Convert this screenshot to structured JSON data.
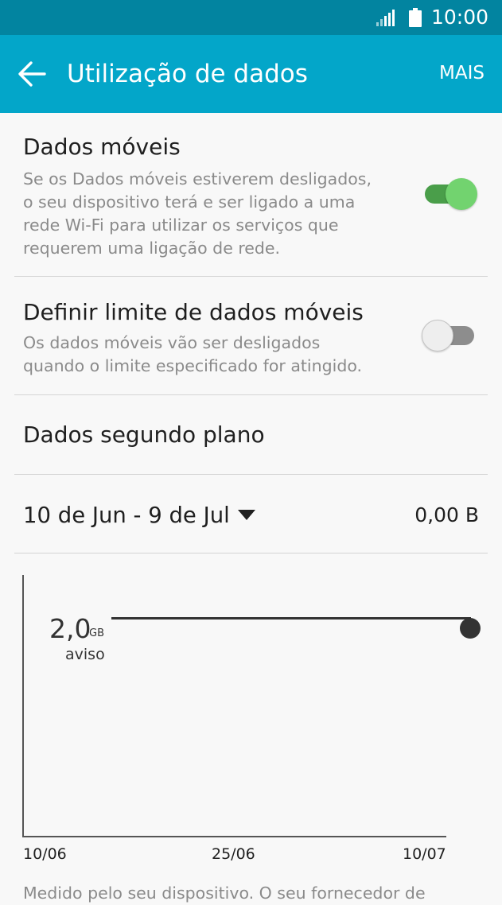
{
  "status_bar": {
    "time": "10:00",
    "signal_icon": "signal-icon",
    "battery_icon": "battery-icon"
  },
  "app_bar": {
    "title": "Utilização de dados",
    "more_label": "MAIS",
    "back_icon": "arrow-left-icon",
    "background_color": "#03a6c9"
  },
  "settings": {
    "mobile_data": {
      "title": "Dados móveis",
      "description_lines": [
        "Se os Dados móveis estiverem desligados,",
        "o seu dispositivo terá e ser ligado a uma",
        "rede Wi-Fi para utilizar os serviços que",
        "requerem uma ligação de rede."
      ],
      "enabled": true
    },
    "data_limit": {
      "title": "Definir limite de dados móveis",
      "description_lines": [
        "Os dados móveis vão ser desligados",
        "quando o limite especificado for atingido."
      ],
      "enabled": false
    },
    "background_data": {
      "title": "Dados segundo plano"
    }
  },
  "usage": {
    "cycle": "10 de Jun - 9 de Jul",
    "total": "0,00 B"
  },
  "chart": {
    "warning_value": "2,0",
    "warning_unit": "GB",
    "warning_label": "aviso",
    "x_ticks": [
      "10/06",
      "25/06",
      "10/07"
    ]
  },
  "footer": {
    "text": "Medido pelo seu dispositivo. O seu fornecedor de"
  }
}
